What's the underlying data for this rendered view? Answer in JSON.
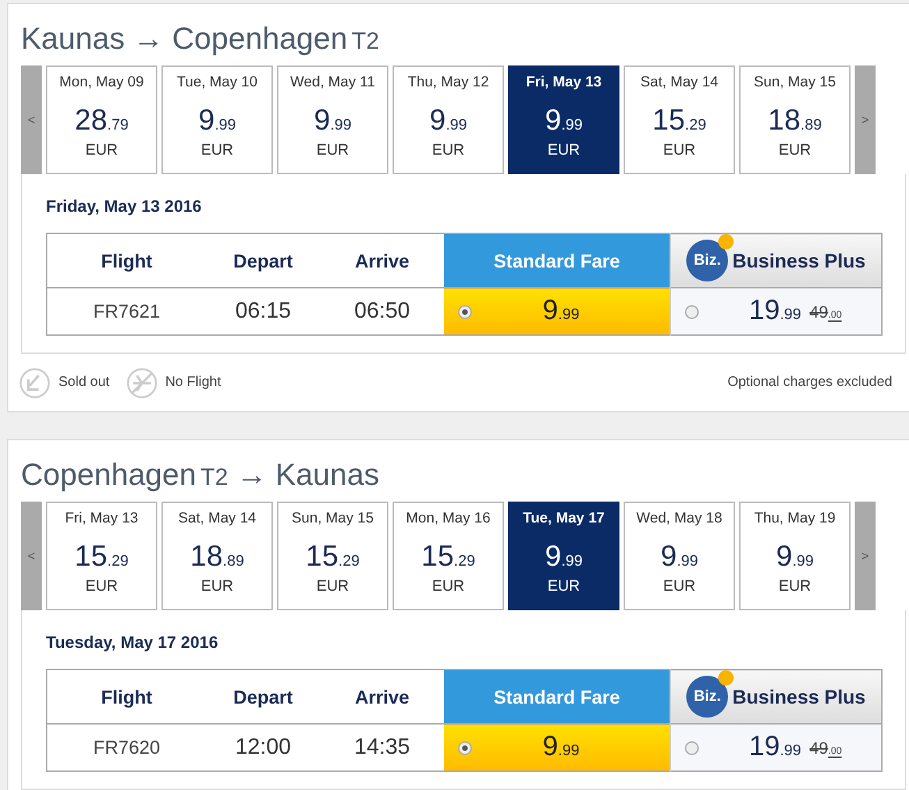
{
  "journeys": [
    {
      "from": {
        "city": "Kaunas"
      },
      "arrow": "→",
      "to": {
        "city": "Copenhagen",
        "terminal": "T2"
      },
      "prev": "<",
      "next": ">",
      "dates": [
        {
          "label": "Mon, May 09",
          "main": "28",
          "cents": ".79",
          "currency": "EUR",
          "selected": false
        },
        {
          "label": "Tue, May 10",
          "main": "9",
          "cents": ".99",
          "currency": "EUR",
          "selected": false
        },
        {
          "label": "Wed, May 11",
          "main": "9",
          "cents": ".99",
          "currency": "EUR",
          "selected": false
        },
        {
          "label": "Thu, May 12",
          "main": "9",
          "cents": ".99",
          "currency": "EUR",
          "selected": false
        },
        {
          "label": "Fri, May 13",
          "main": "9",
          "cents": ".99",
          "currency": "EUR",
          "selected": true
        },
        {
          "label": "Sat, May 14",
          "main": "15",
          "cents": ".29",
          "currency": "EUR",
          "selected": false
        },
        {
          "label": "Sun, May 15",
          "main": "18",
          "cents": ".89",
          "currency": "EUR",
          "selected": false
        }
      ],
      "date_heading": "Friday, May 13 2016",
      "columns": [
        "Flight",
        "Depart",
        "Arrive"
      ],
      "standard_header": "Standard Fare",
      "business_logo": "Biz.",
      "business_header": "Business Plus",
      "flights": [
        {
          "flight": "FR7621",
          "depart": "06:15",
          "arrive": "06:50",
          "standard": {
            "main": "9",
            "cents": ".99",
            "selected": true
          },
          "business": {
            "main": "19",
            "cents": ".99",
            "old_main": "49",
            "old_cents": ".00",
            "selected": false
          }
        }
      ],
      "legend": [
        {
          "kind": "sold_out",
          "label": "Sold out"
        },
        {
          "kind": "no_flight",
          "label": "No Flight"
        }
      ],
      "note": "Optional charges excluded"
    },
    {
      "from": {
        "city": "Copenhagen",
        "terminal": "T2"
      },
      "arrow": "→",
      "to": {
        "city": "Kaunas"
      },
      "prev": "<",
      "next": ">",
      "dates": [
        {
          "label": "Fri, May 13",
          "main": "15",
          "cents": ".29",
          "currency": "EUR",
          "selected": false
        },
        {
          "label": "Sat, May 14",
          "main": "18",
          "cents": ".89",
          "currency": "EUR",
          "selected": false
        },
        {
          "label": "Sun, May 15",
          "main": "15",
          "cents": ".29",
          "currency": "EUR",
          "selected": false
        },
        {
          "label": "Mon, May 16",
          "main": "15",
          "cents": ".29",
          "currency": "EUR",
          "selected": false
        },
        {
          "label": "Tue, May 17",
          "main": "9",
          "cents": ".99",
          "currency": "EUR",
          "selected": true
        },
        {
          "label": "Wed, May 18",
          "main": "9",
          "cents": ".99",
          "currency": "EUR",
          "selected": false
        },
        {
          "label": "Thu, May 19",
          "main": "9",
          "cents": ".99",
          "currency": "EUR",
          "selected": false
        }
      ],
      "date_heading": "Tuesday, May 17 2016",
      "columns": [
        "Flight",
        "Depart",
        "Arrive"
      ],
      "standard_header": "Standard Fare",
      "business_logo": "Biz.",
      "business_header": "Business Plus",
      "flights": [
        {
          "flight": "FR7620",
          "depart": "12:00",
          "arrive": "14:35",
          "standard": {
            "main": "9",
            "cents": ".99",
            "selected": true
          },
          "business": {
            "main": "19",
            "cents": ".99",
            "old_main": "49",
            "old_cents": ".00",
            "selected": false
          }
        }
      ]
    }
  ]
}
